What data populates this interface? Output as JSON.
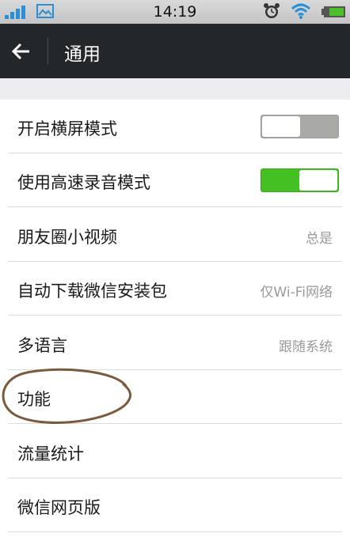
{
  "status_bar": {
    "time": "14:19",
    "icons": [
      "signal-icon",
      "gallery-icon",
      "alarm-icon",
      "wifi-icon",
      "battery-icon"
    ]
  },
  "header": {
    "back_icon": "back-arrow-icon",
    "title": "通用"
  },
  "settings": [
    {
      "label": "开启横屏模式",
      "type": "toggle",
      "state": "off"
    },
    {
      "label": "使用高速录音模式",
      "type": "toggle",
      "state": "on"
    },
    {
      "label": "朋友圈小视频",
      "value": "总是"
    },
    {
      "label": "自动下载微信安装包",
      "value": "仅Wi-Fi网络"
    },
    {
      "label": "多语言",
      "value": "跟随系统"
    },
    {
      "label": "功能",
      "value": ""
    },
    {
      "label": "流量统计",
      "value": ""
    },
    {
      "label": "微信网页版",
      "value": ""
    }
  ],
  "colors": {
    "toggle_on": "#44c022",
    "toggle_off": "#a9aaa6",
    "app_bar": "#23272a",
    "signal": "#2a8fd6",
    "annotation": "#7a5a3c"
  }
}
